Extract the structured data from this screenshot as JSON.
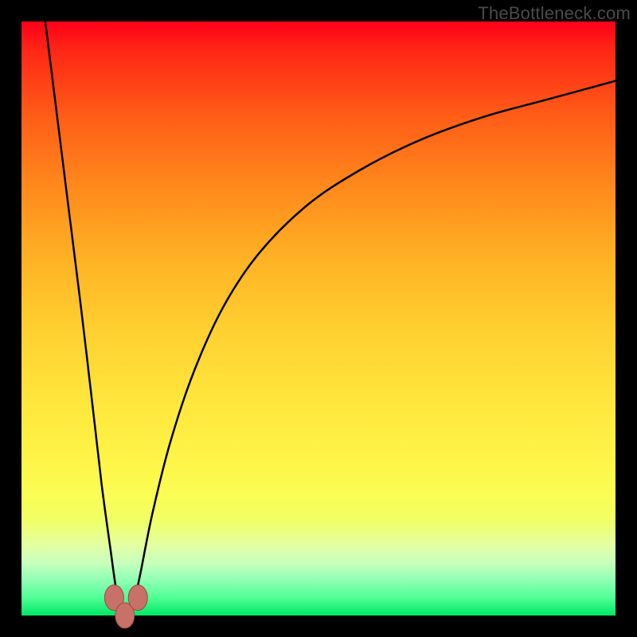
{
  "watermark": "TheBottleneck.com",
  "colors": {
    "frame": "#000000",
    "curve": "#000000",
    "marker_fill": "#c77168",
    "marker_stroke": "#9c4a43",
    "gradient_top": "#ff0018",
    "gradient_bottom": "#00e765"
  },
  "chart_data": {
    "type": "line",
    "title": "",
    "xlabel": "",
    "ylabel": "",
    "xlim": [
      0,
      100
    ],
    "ylim": [
      0,
      100
    ],
    "grid": false,
    "axes_visible": false,
    "notes": "Bottleneck-style curve: y=100 is top edge, y=0 is bottom green band. Two branches meet near x≈17 at y≈0 (optimal point). Left branch rises steeply to y=100 at x≈4; right branch rises toward y≈90 at x=100.",
    "series": [
      {
        "name": "left-branch",
        "x": [
          4.0,
          6.0,
          8.0,
          10.0,
          12.0,
          13.5,
          15.0,
          16.0,
          17.0
        ],
        "y": [
          100,
          84,
          68,
          52,
          35,
          22,
          11,
          4,
          0
        ]
      },
      {
        "name": "right-branch",
        "x": [
          18.5,
          20.0,
          22.0,
          25.0,
          29.0,
          34.0,
          40.0,
          48.0,
          57.0,
          67.0,
          78.0,
          89.0,
          100.0
        ],
        "y": [
          0,
          7,
          17,
          29,
          41,
          52,
          61,
          69,
          75,
          80,
          84,
          87,
          90
        ]
      }
    ],
    "markers": [
      {
        "name": "valley-left",
        "x": 15.6,
        "y": 3.0
      },
      {
        "name": "valley-bottom",
        "x": 17.4,
        "y": 0.0
      },
      {
        "name": "valley-right",
        "x": 19.6,
        "y": 3.0
      }
    ]
  }
}
